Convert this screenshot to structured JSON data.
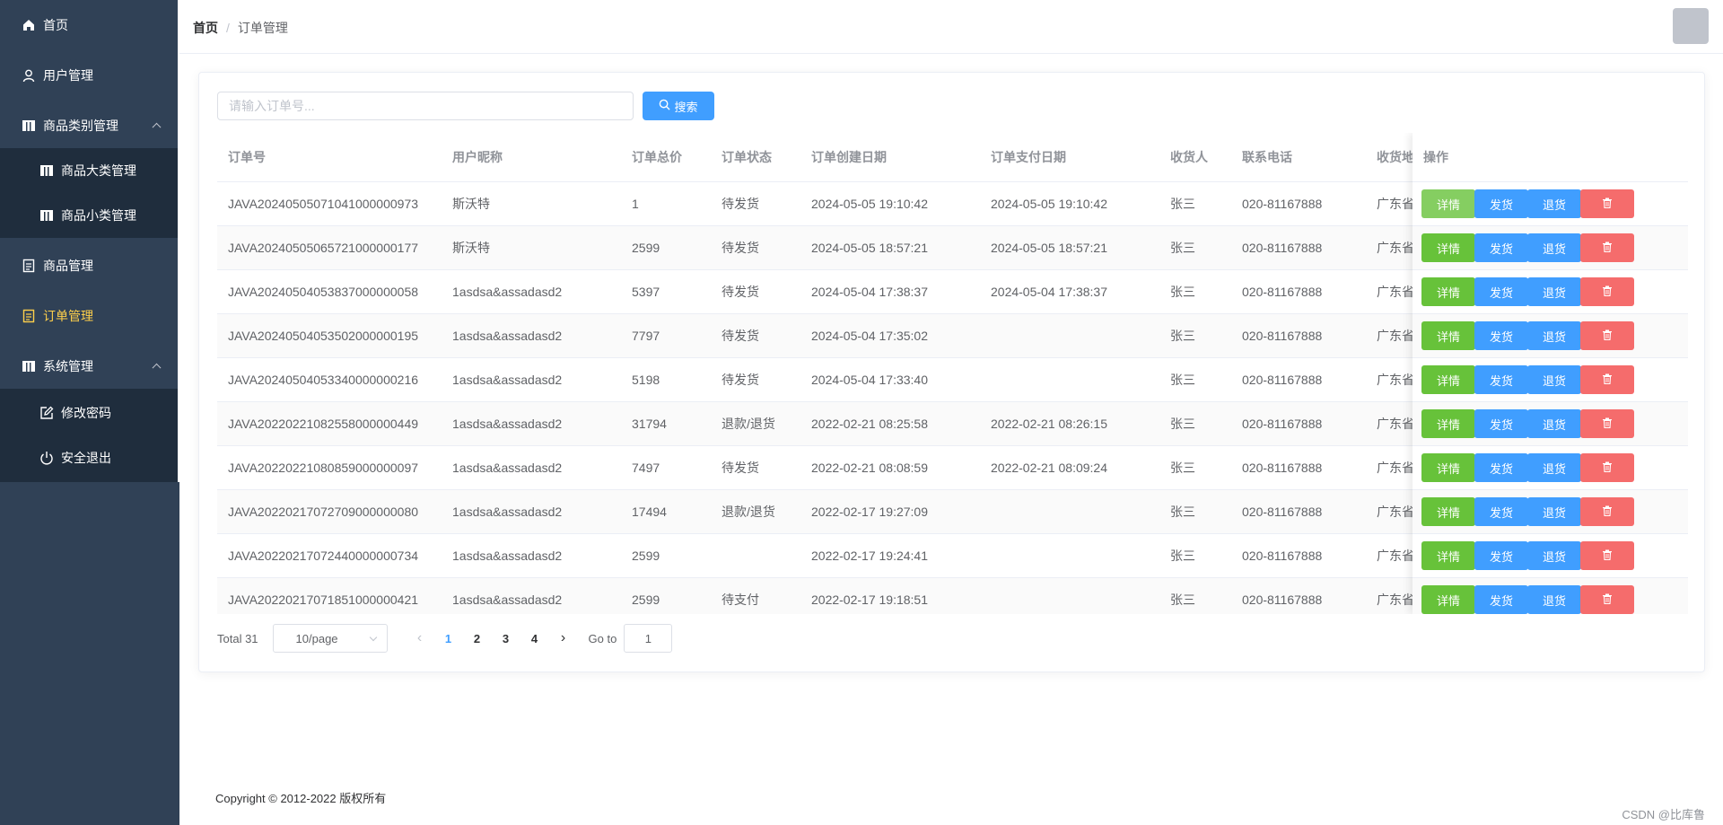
{
  "sidebar": {
    "items": [
      {
        "label": "首页",
        "icon": "home-icon"
      },
      {
        "label": "用户管理",
        "icon": "user-icon"
      },
      {
        "label": "商品类别管理",
        "icon": "category-icon"
      },
      {
        "label": "商品大类管理",
        "icon": "category-icon"
      },
      {
        "label": "商品小类管理",
        "icon": "category-icon"
      },
      {
        "label": "商品管理",
        "icon": "document-icon"
      },
      {
        "label": "订单管理",
        "icon": "order-icon"
      },
      {
        "label": "系统管理",
        "icon": "category-icon"
      },
      {
        "label": "修改密码",
        "icon": "edit-icon"
      },
      {
        "label": "安全退出",
        "icon": "power-icon"
      }
    ],
    "active_color": "#ffd04b",
    "bg_color": "#304156"
  },
  "header": {
    "breadcrumb_home": "首页",
    "breadcrumb_sep": "/",
    "breadcrumb_current": "订单管理"
  },
  "search": {
    "placeholder": "请输入订单号...",
    "button_label": "搜索"
  },
  "table": {
    "columns": [
      "订单号",
      "用户昵称",
      "订单总价",
      "订单状态",
      "订单创建日期",
      "订单支付日期",
      "收货人",
      "联系电话",
      "收货地址",
      "操作"
    ],
    "rows": [
      {
        "order_no": "JAVA20240505071041000000973",
        "user": "斯沃特",
        "total": "1",
        "status": "待发货",
        "created": "2024-05-05 19:10:42",
        "paid": "2024-05-05 19:10:42",
        "receiver": "张三",
        "phone": "020-81167888",
        "address": "广东省广州市"
      },
      {
        "order_no": "JAVA20240505065721000000177",
        "user": "斯沃特",
        "total": "2599",
        "status": "待发货",
        "created": "2024-05-05 18:57:21",
        "paid": "2024-05-05 18:57:21",
        "receiver": "张三",
        "phone": "020-81167888",
        "address": "广东省广州市"
      },
      {
        "order_no": "JAVA20240504053837000000058",
        "user": "1asdsa&assadasd2",
        "total": "5397",
        "status": "待发货",
        "created": "2024-05-04 17:38:37",
        "paid": "2024-05-04 17:38:37",
        "receiver": "张三",
        "phone": "020-81167888",
        "address": "广东省广州市"
      },
      {
        "order_no": "JAVA20240504053502000000195",
        "user": "1asdsa&assadasd2",
        "total": "7797",
        "status": "待发货",
        "created": "2024-05-04 17:35:02",
        "paid": "",
        "receiver": "张三",
        "phone": "020-81167888",
        "address": "广东省广州市"
      },
      {
        "order_no": "JAVA20240504053340000000216",
        "user": "1asdsa&assadasd2",
        "total": "5198",
        "status": "待发货",
        "created": "2024-05-04 17:33:40",
        "paid": "",
        "receiver": "张三",
        "phone": "020-81167888",
        "address": "广东省广州市"
      },
      {
        "order_no": "JAVA20220221082558000000449",
        "user": "1asdsa&assadasd2",
        "total": "31794",
        "status": "退款/退货",
        "created": "2022-02-21 08:25:58",
        "paid": "2022-02-21 08:26:15",
        "receiver": "张三",
        "phone": "020-81167888",
        "address": "广东省广州市"
      },
      {
        "order_no": "JAVA20220221080859000000097",
        "user": "1asdsa&assadasd2",
        "total": "7497",
        "status": "待发货",
        "created": "2022-02-21 08:08:59",
        "paid": "2022-02-21 08:09:24",
        "receiver": "张三",
        "phone": "020-81167888",
        "address": "广东省广州市"
      },
      {
        "order_no": "JAVA20220217072709000000080",
        "user": "1asdsa&assadasd2",
        "total": "17494",
        "status": "退款/退货",
        "created": "2022-02-17 19:27:09",
        "paid": "",
        "receiver": "张三",
        "phone": "020-81167888",
        "address": "广东省广州市"
      },
      {
        "order_no": "JAVA20220217072440000000734",
        "user": "1asdsa&assadasd2",
        "total": "2599",
        "status": "",
        "created": "2022-02-17 19:24:41",
        "paid": "",
        "receiver": "张三",
        "phone": "020-81167888",
        "address": "广东省广州市"
      },
      {
        "order_no": "JAVA20220217071851000000421",
        "user": "1asdsa&assadasd2",
        "total": "2599",
        "status": "待支付",
        "created": "2022-02-17 19:18:51",
        "paid": "",
        "receiver": "张三",
        "phone": "020-81167888",
        "address": "广东省广州市"
      }
    ],
    "actions": {
      "detail": "详情",
      "ship": "发货",
      "refund": "退货",
      "delete_icon": "trash-icon"
    }
  },
  "pagination": {
    "total": "Total 31",
    "page_size": "10/page",
    "pages": [
      "1",
      "2",
      "3",
      "4"
    ],
    "current": "1",
    "goto_label": "Go to",
    "goto_value": "1"
  },
  "footer": {
    "copyright": "Copyright © 2012-2022 版权所有"
  },
  "watermark": "CSDN @比库鲁"
}
